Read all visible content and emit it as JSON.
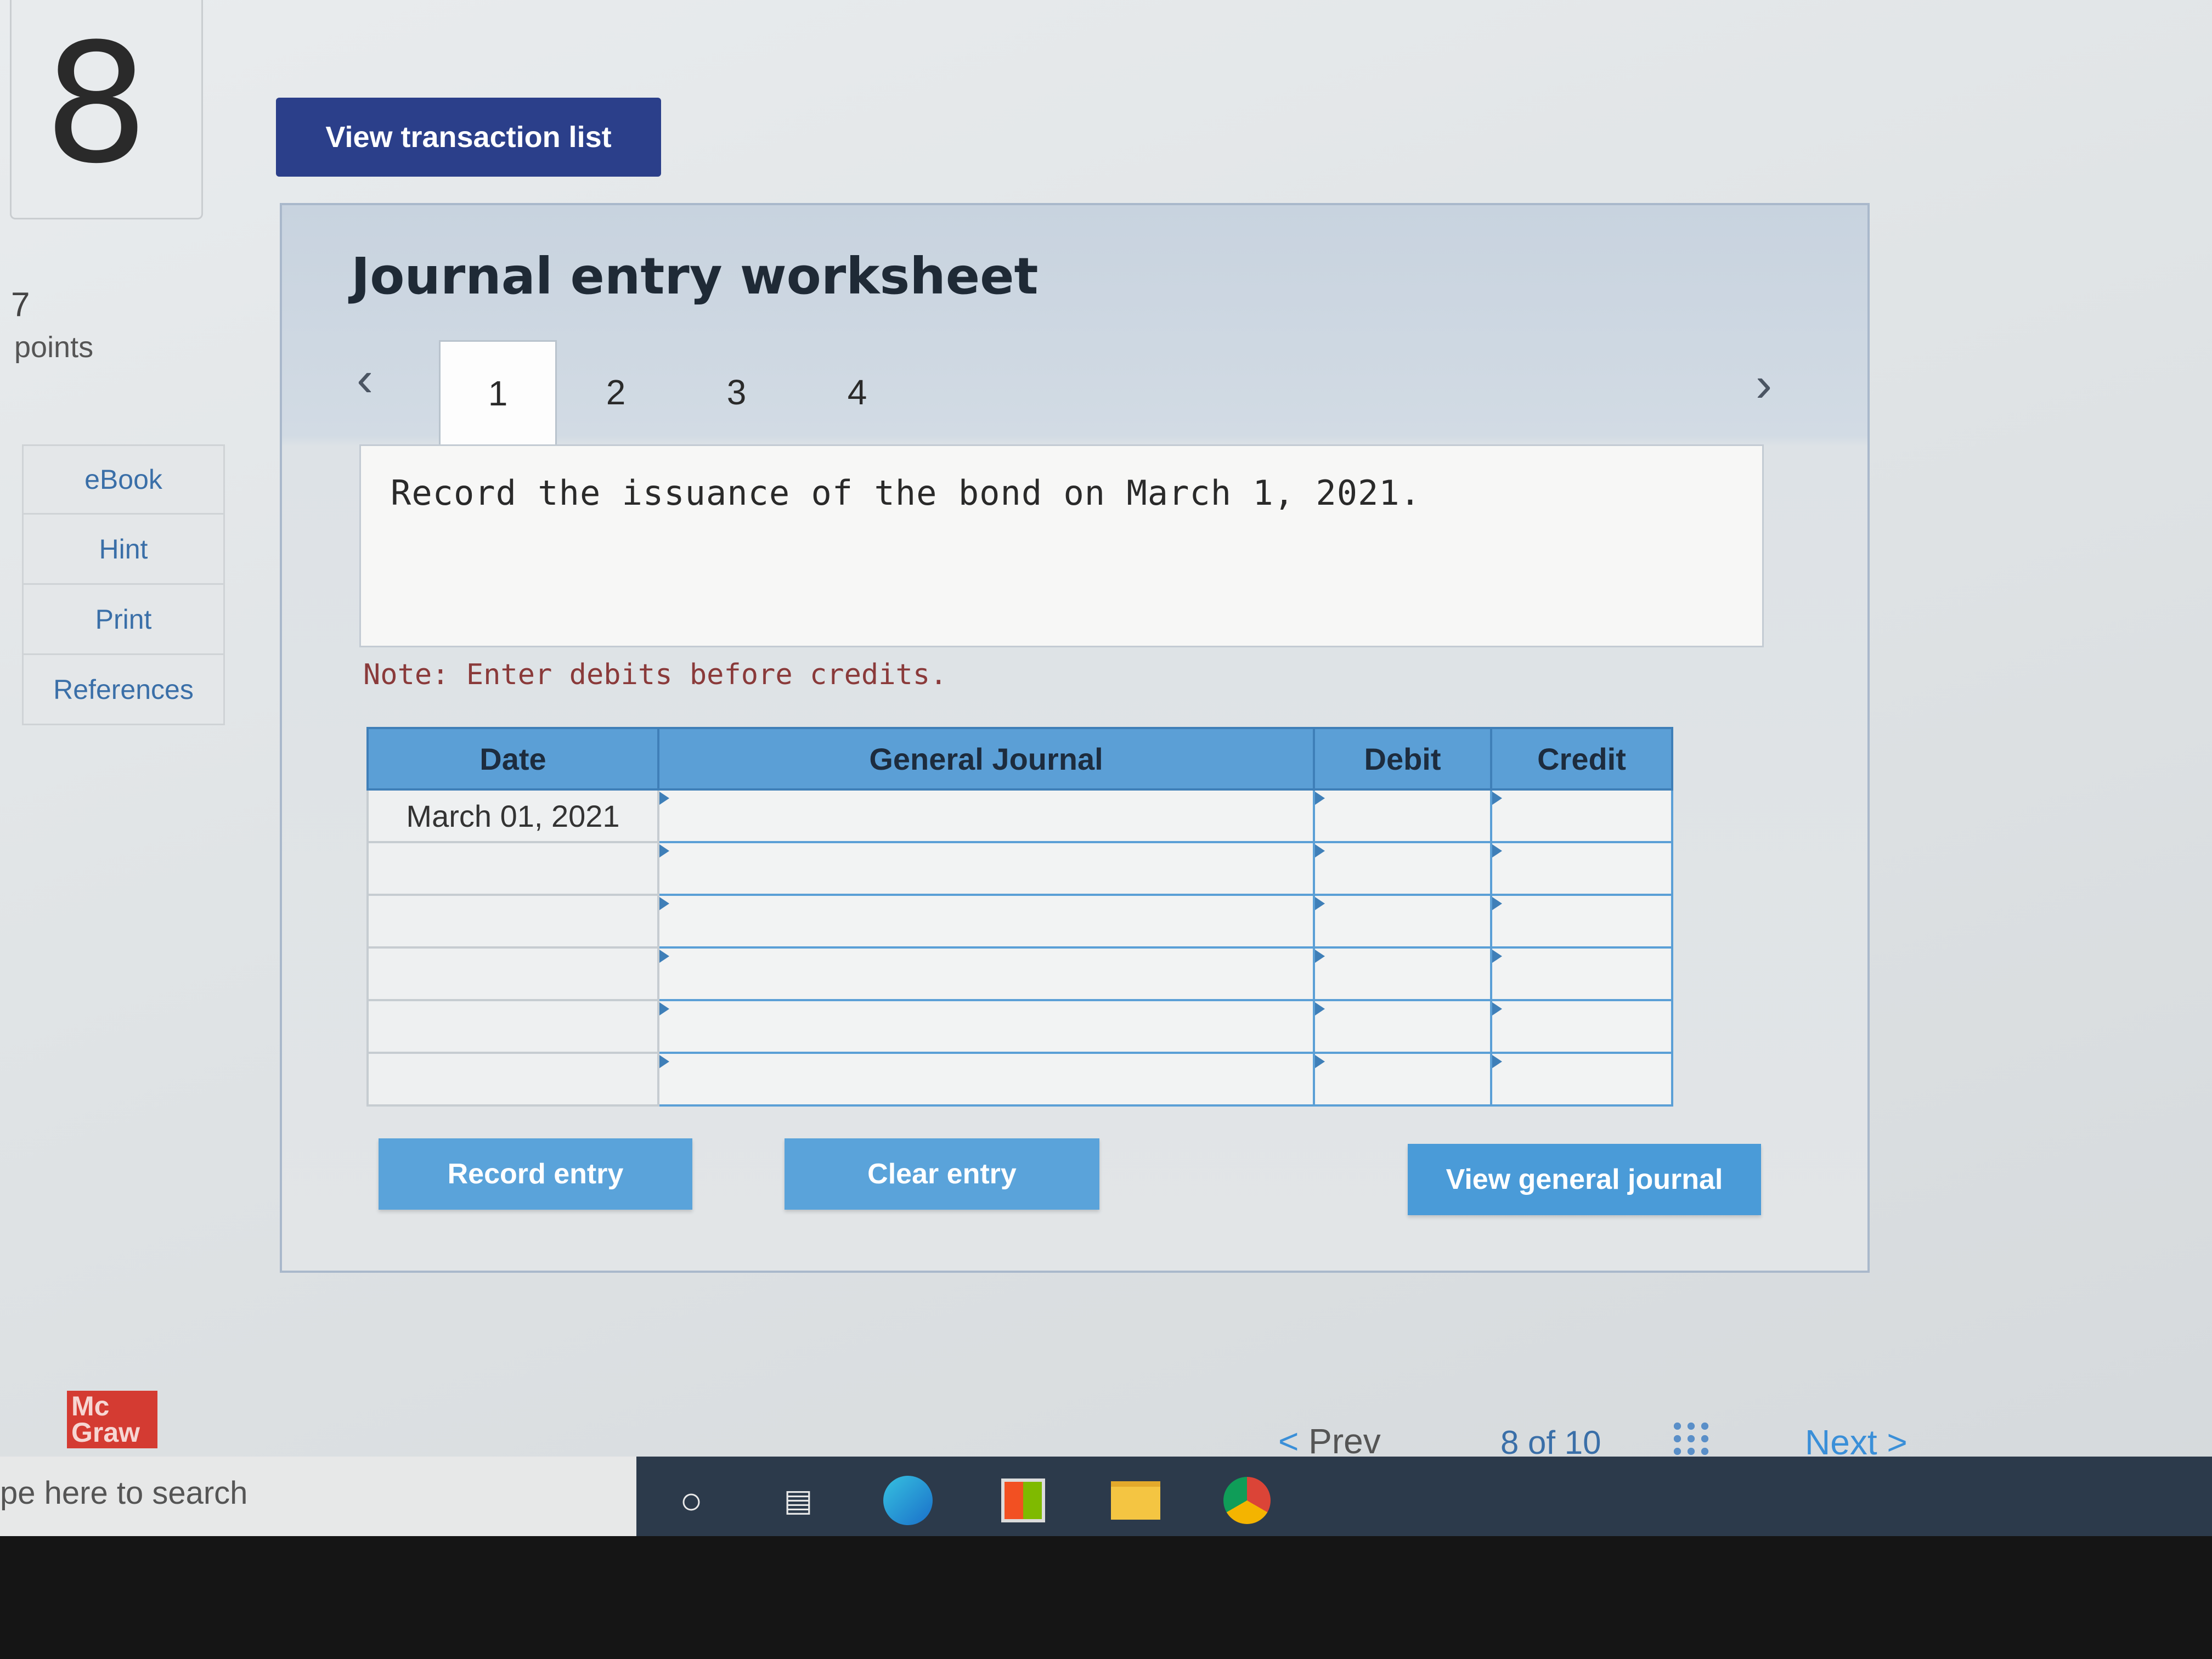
{
  "question": {
    "number": "8",
    "points_value": "7",
    "points_label": "points"
  },
  "side_menu": [
    "eBook",
    "Hint",
    "Print",
    "References"
  ],
  "view_transaction_list": "View transaction list",
  "worksheet": {
    "title": "Journal entry worksheet",
    "tabs": [
      "1",
      "2",
      "3",
      "4"
    ],
    "active_tab": "1",
    "prompt": "Record the issuance of the bond on March 1, 2021.",
    "note": "Note: Enter debits before credits."
  },
  "journal": {
    "headers": {
      "date": "Date",
      "general_journal": "General Journal",
      "debit": "Debit",
      "credit": "Credit"
    },
    "rows": [
      {
        "date": "March 01, 2021",
        "account": "",
        "debit": "",
        "credit": ""
      },
      {
        "date": "",
        "account": "",
        "debit": "",
        "credit": ""
      },
      {
        "date": "",
        "account": "",
        "debit": "",
        "credit": ""
      },
      {
        "date": "",
        "account": "",
        "debit": "",
        "credit": ""
      },
      {
        "date": "",
        "account": "",
        "debit": "",
        "credit": ""
      },
      {
        "date": "",
        "account": "",
        "debit": "",
        "credit": ""
      }
    ]
  },
  "buttons": {
    "record": "Record entry",
    "clear": "Clear entry",
    "view_general": "View general journal"
  },
  "logo": {
    "line1": "Mc",
    "line2": "Graw"
  },
  "pagination": {
    "prev": "Prev",
    "current": "8",
    "of_label": "of",
    "total": "10",
    "next": "Next"
  },
  "taskbar": {
    "search_placeholder": "pe here to search"
  },
  "colors": {
    "dark_button": "#2b3f8a",
    "accent_blue": "#5aa3da",
    "header_blue": "#5b9fd6",
    "logo_red": "#d43b32"
  }
}
